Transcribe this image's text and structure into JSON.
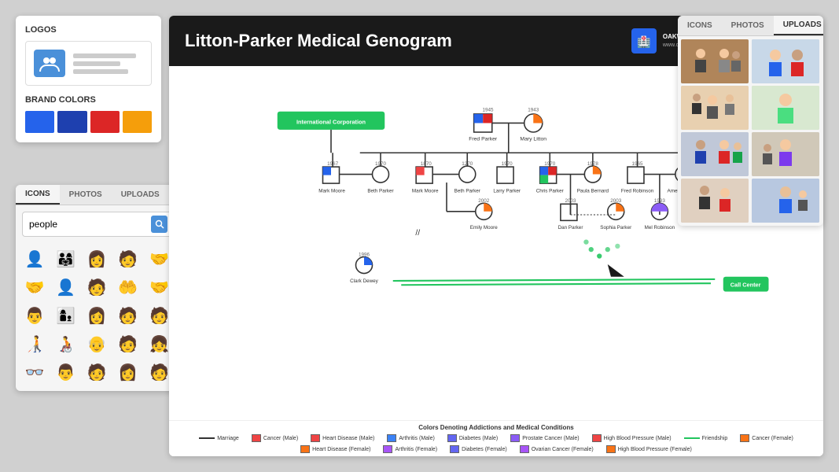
{
  "left_panel_logos": {
    "section_logos": "LOGOS",
    "section_brand": "BRAND COLORS",
    "brand_colors": [
      "#2563eb",
      "#1e40af",
      "#dc2626",
      "#f59e0b"
    ]
  },
  "left_panel_icons": {
    "tabs": [
      "ICONS",
      "PHOTOS",
      "UPLOADS"
    ],
    "active_tab": "ICONS",
    "search_placeholder": "people",
    "search_value": "people",
    "icons": [
      "👤",
      "👨‍👩‍👧",
      "👩",
      "👨",
      "🤝",
      "🤝",
      "👤",
      "👤",
      "🤝",
      "🤝",
      "👤",
      "👨‍👩‍👧",
      "👩",
      "🧑",
      "🧑",
      "👤",
      "🧑‍🦯",
      "🧑",
      "👴",
      "🧑",
      "👓",
      "🧑",
      "🧑",
      "🧑",
      "🧑"
    ]
  },
  "right_panel": {
    "tabs": [
      "ICONS",
      "PHOTOS",
      "UPLOADS"
    ],
    "active_tab": "UPLOADS"
  },
  "header": {
    "title": "Litton-Parker Medical Genogram",
    "logo_name": "OAKWOOD MEDICAL RESEARCH FOUNDATION",
    "logo_sub": "www.oakwoodmedical.com"
  },
  "legend": {
    "title": "Colors Denoting Addictions and Medical Conditions",
    "items": [
      {
        "symbol": "line",
        "color": "#000",
        "label": "Marriage"
      },
      {
        "symbol": "line",
        "color": "#22c55e",
        "label": "Friendship"
      },
      {
        "symbol": "square",
        "color": "#ef4444",
        "label": "Cancer (Male)"
      },
      {
        "symbol": "square",
        "color": "#f97316",
        "label": "Cancer (Female)"
      },
      {
        "symbol": "square",
        "color": "#ef4444",
        "label": "Heart Disease (Male)"
      },
      {
        "symbol": "square",
        "color": "#f97316",
        "label": "Heart Disease (Female)"
      },
      {
        "symbol": "square",
        "color": "#3b82f6",
        "label": "Arthritis (Male)"
      },
      {
        "symbol": "square",
        "color": "#a855f7",
        "label": "Arthritis (Female)"
      },
      {
        "symbol": "square",
        "color": "#6366f1",
        "label": "Diabetes (Male)"
      },
      {
        "symbol": "square",
        "color": "#6366f1",
        "label": "Diabetes (Female)"
      },
      {
        "symbol": "square",
        "color": "#8b5cf6",
        "label": "Prostate Cancer (Male)"
      },
      {
        "symbol": "square",
        "color": "#a855f7",
        "label": "Ovarian Cancer (Female)"
      },
      {
        "symbol": "square",
        "color": "#ef4444",
        "label": "High Blood Pressure  (Male)"
      },
      {
        "symbol": "square",
        "color": "#f97316",
        "label": "High Blood Pressure (Female)"
      }
    ]
  }
}
